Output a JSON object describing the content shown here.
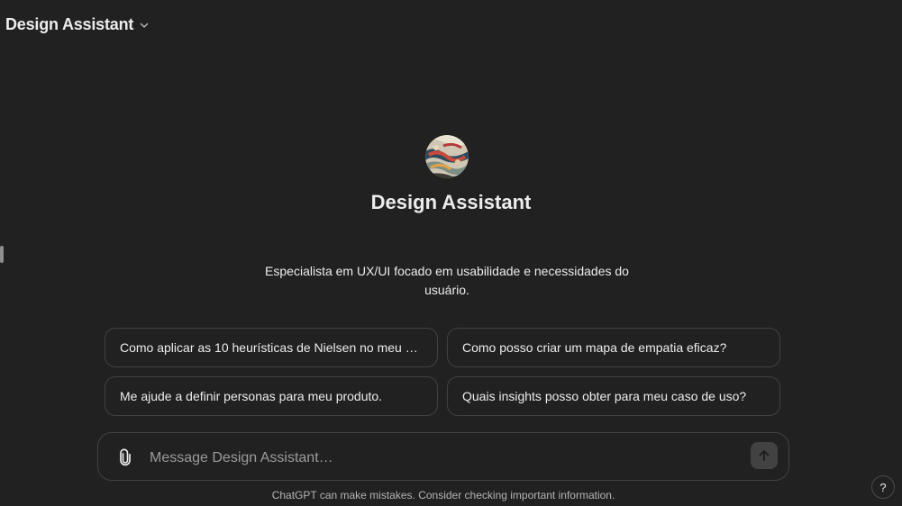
{
  "header": {
    "model_title": "Design Assistant",
    "dropdown_icon": "chevron-down-icon"
  },
  "gpt": {
    "name": "Design Assistant",
    "description": "Especialista em UX/UI focado em usabilidade e necessidades do usuário.",
    "avatar_icon": "gpt-avatar-image"
  },
  "starters": [
    {
      "label": "Como aplicar as 10 heurísticas de Nielsen no meu pr..."
    },
    {
      "label": "Como posso criar um mapa de empatia eficaz?"
    },
    {
      "label": "Me ajude a definir personas para meu produto."
    },
    {
      "label": "Quais insights posso obter para meu caso de uso?"
    }
  ],
  "composer": {
    "placeholder": "Message Design Assistant…",
    "value": "",
    "attach_icon": "paperclip-icon",
    "send_icon": "arrow-up-icon"
  },
  "footer": {
    "disclaimer": "ChatGPT can make mistakes. Consider checking important information.",
    "help_label": "?"
  },
  "colors": {
    "background": "#212121",
    "text": "#ececec",
    "border": "#424242",
    "muted_text": "#9b9b9b"
  }
}
